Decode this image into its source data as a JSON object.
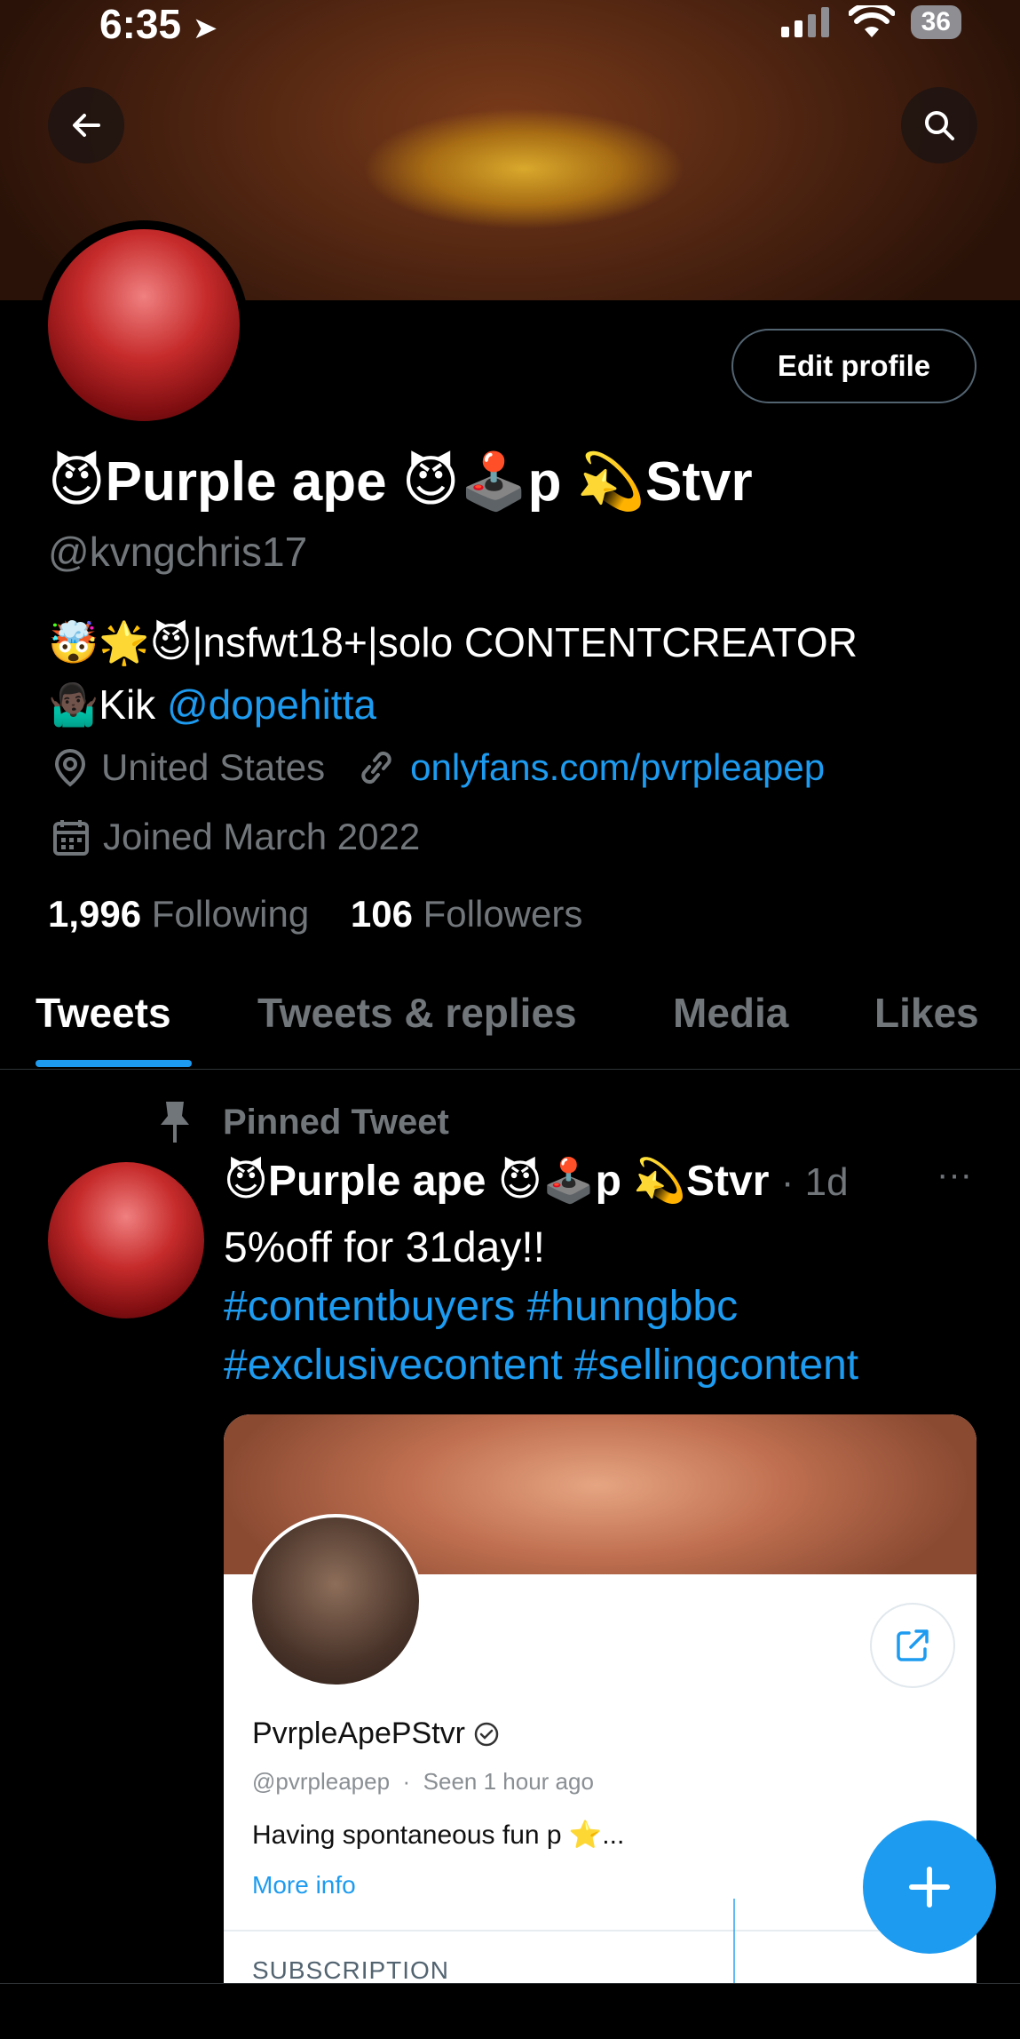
{
  "status_bar": {
    "time": "6:35",
    "battery": "36"
  },
  "profile": {
    "display_name": "😈Purple ape 😈🕹️p 💫Stvr",
    "handle": "@kvngchris17",
    "edit_button": "Edit profile",
    "bio_line1": "🤯🌟😈|nsfwt18+|solo CONTENTCREATOR",
    "bio_line2_prefix": "🤷🏿‍♂️Kik ",
    "bio_mention": "@dopehitta",
    "location": "United States",
    "website": "onlyfans.com/pvrpleapep",
    "joined": "Joined March 2022",
    "following_count": "1,996",
    "following_label": "Following",
    "followers_count": "106",
    "followers_label": "Followers"
  },
  "tabs": [
    {
      "label": "Tweets",
      "active": true
    },
    {
      "label": "Tweets & replies",
      "active": false
    },
    {
      "label": "Media",
      "active": false
    },
    {
      "label": "Likes",
      "active": false
    }
  ],
  "pinned_tweet": {
    "pinned_label": "Pinned Tweet",
    "author": "😈Purple ape 😈🕹️p 💫Stvr",
    "time": "· 1d",
    "more": "···",
    "text_line1": "5%off for 31day!!",
    "hashtags_line1": "#contentbuyers #hunngbbc",
    "hashtags_line2": "#exclusivecontent #sellingcontent",
    "card": {
      "name": "PvrpleApePStvr",
      "username": "@pvrpleapep",
      "separator": "·",
      "seen": "Seen 1 hour ago",
      "description": "Having spontaneous fun p ⭐...",
      "more_info": "More info",
      "subscription_label": "SUBSCRIPTION"
    }
  },
  "colors": {
    "accent": "#1d9bf0",
    "background": "#000000",
    "muted": "#71767b"
  }
}
